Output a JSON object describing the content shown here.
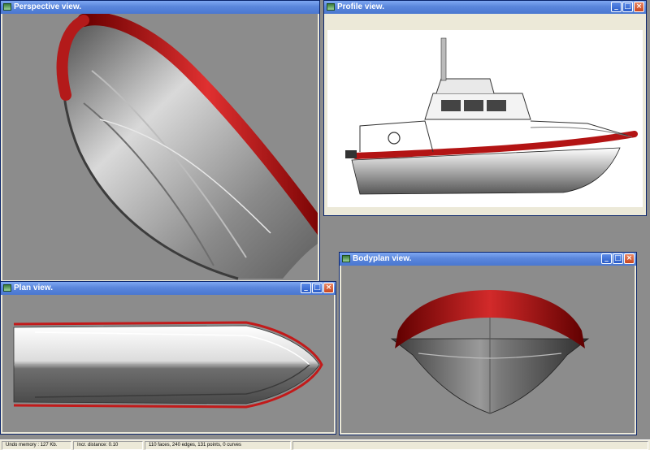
{
  "windows": {
    "perspective": {
      "title": "Perspective view."
    },
    "profile": {
      "title": "Profile view."
    },
    "plan": {
      "title": "Plan view."
    },
    "bodyplan": {
      "title": "Bodyplan view."
    }
  },
  "window_buttons": {
    "minimize": "_",
    "maximize": "□",
    "close": "×"
  },
  "status": {
    "undo_memory": "Undo memory : 127 Kb.",
    "incr_distance": "Incr. distance: 0.10",
    "model_stats": "110 faces, 240 edges, 131 points, 0 curves"
  },
  "colors": {
    "desktop": "#8c8c8c",
    "titlebar": "#4a77d0",
    "fender": "#cc1a1a",
    "profile_bg": "#ffffff"
  },
  "icons": [
    "app-icon",
    "minimize-icon",
    "maximize-icon",
    "close-icon"
  ]
}
